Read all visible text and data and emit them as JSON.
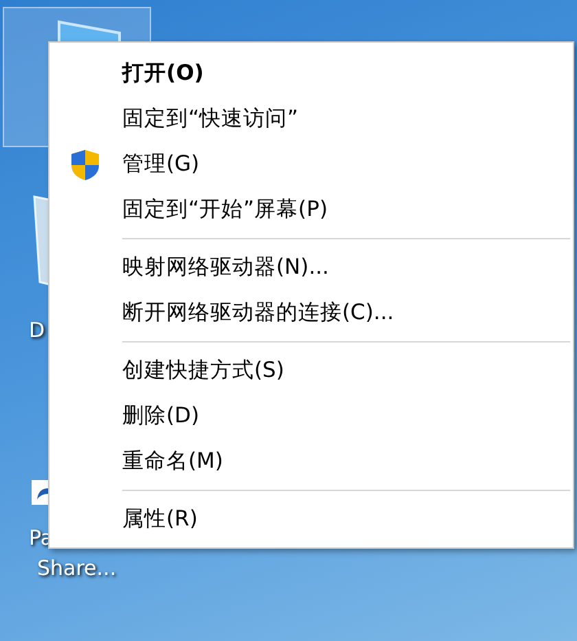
{
  "desktop_icons": [
    {
      "kind": "pc",
      "selected": true
    },
    {
      "kind": "bin",
      "label_lines": [
        "D"
      ],
      "selected": false
    },
    {
      "kind": "shortcut",
      "label_lines": [
        "Pa",
        "Share..."
      ],
      "selected": false
    }
  ],
  "context_menu": {
    "groups": [
      [
        {
          "label": "打开(O)",
          "default": true
        },
        {
          "label": "固定到“快速访问”",
          "default": false
        },
        {
          "label": "管理(G)",
          "default": false,
          "kind": "elevated"
        },
        {
          "label": "固定到“开始”屏幕(P)",
          "default": false
        }
      ],
      [
        {
          "label": "映射网络驱动器(N)...",
          "default": false
        },
        {
          "label": "断开网络驱动器的连接(C)...",
          "default": false
        }
      ],
      [
        {
          "label": "创建快捷方式(S)",
          "default": false
        },
        {
          "label": "删除(D)",
          "default": false
        },
        {
          "label": "重命名(M)",
          "default": false
        }
      ],
      [
        {
          "label": "属性(R)",
          "default": false
        }
      ]
    ]
  }
}
